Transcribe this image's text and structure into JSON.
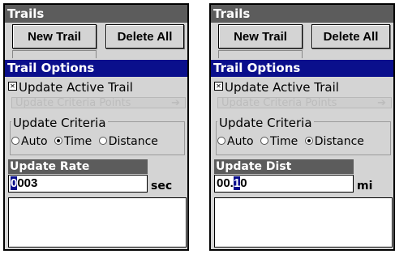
{
  "panels": [
    {
      "header": "Trails",
      "buttons": {
        "new_trail": "New Trail",
        "delete_all": "Delete All"
      },
      "options_header": "Trail Options",
      "checkbox_label": "Update Active Trail",
      "checkbox_checked": true,
      "ghost_dropdown": "Update Criteria Points",
      "group_title": "Update Criteria",
      "radio_options": [
        "Auto",
        "Time",
        "Distance"
      ],
      "radio_selected": "Time",
      "field_label": "Update Rate",
      "field_value_cursor": "0",
      "field_value_rest": "003",
      "field_unit": "sec"
    },
    {
      "header": "Trails",
      "buttons": {
        "new_trail": "New Trail",
        "delete_all": "Delete All"
      },
      "options_header": "Trail Options",
      "checkbox_label": "Update Active Trail",
      "checkbox_checked": true,
      "ghost_dropdown": "Update Criteria Points",
      "group_title": "Update Criteria",
      "radio_options": [
        "Auto",
        "Time",
        "Distance"
      ],
      "radio_selected": "Distance",
      "field_label": "Update Dist",
      "field_value_before": "00.",
      "field_value_cursor": "1",
      "field_value_after": "0",
      "field_unit": "mi"
    }
  ],
  "colors": {
    "title_bar": "#5c5c5c",
    "highlight": "#0a0f8c",
    "background": "#d4d4d4"
  },
  "icons": {
    "checkbox": "x-check-icon",
    "radio": "radio-dot-icon",
    "dropdown": "arrow-right-icon"
  }
}
